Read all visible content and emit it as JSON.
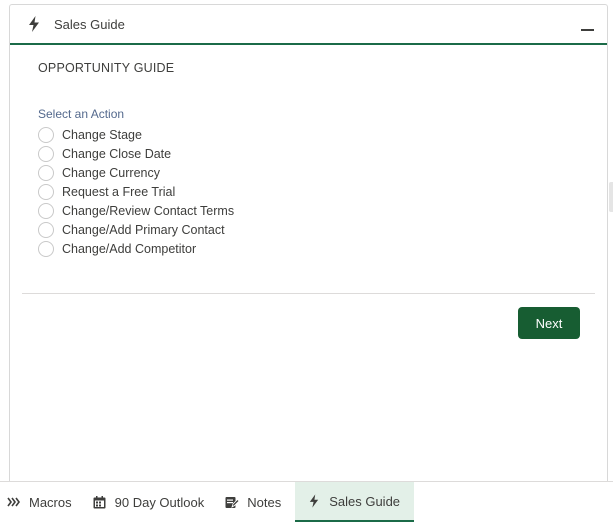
{
  "panel": {
    "title": "Sales Guide",
    "header_icon": "lightning-bolt-icon",
    "minimize_icon": "minimize-icon"
  },
  "guide": {
    "title": "OPPORTUNITY GUIDE",
    "action_label": "Select an Action",
    "options": [
      "Change Stage",
      "Change Close Date",
      "Change Currency",
      "Request a Free Trial",
      "Change/Review Contact Terms",
      "Change/Add Primary Contact",
      "Change/Add Competitor"
    ],
    "next_label": "Next"
  },
  "utility_bar": {
    "items": [
      {
        "label": "Macros",
        "icon": "double-chevron-right-icon"
      },
      {
        "label": "90 Day Outlook",
        "icon": "calendar-icon"
      },
      {
        "label": "Notes",
        "icon": "note-edit-icon"
      },
      {
        "label": "Sales Guide",
        "icon": "lightning-bolt-icon",
        "active": true
      }
    ]
  },
  "colors": {
    "accent": "#1b6b48",
    "button": "#175d32",
    "active_tab_bg": "#e3f0e8"
  }
}
